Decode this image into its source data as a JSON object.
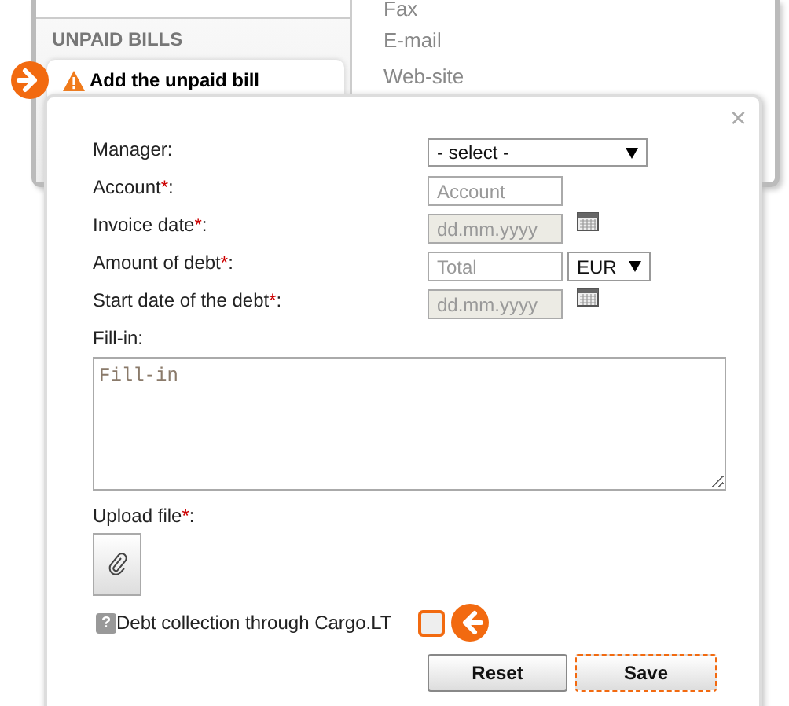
{
  "sidebar": {
    "header": "UNPAID BILLS",
    "item": {
      "label": "Add the unpaid bill",
      "highlighted": true
    }
  },
  "contacts": [
    "Fax",
    "E-mail",
    "Web-site"
  ],
  "dialog": {
    "close": "×",
    "fields": [
      {
        "kind": "select",
        "label": "Manager:",
        "value": "- select -"
      },
      {
        "kind": "text",
        "label": "Account",
        "mark": "*",
        "end": ":",
        "placeholder": "Account"
      },
      {
        "kind": "date",
        "label": "Invoice date",
        "mark": "*",
        "end": ":",
        "placeholder": "dd.mm.yyyy",
        "disabled": true
      },
      {
        "kind": "amount",
        "label": "Amount of debt",
        "mark": "*",
        "end": ":",
        "placeholder": "Total",
        "currency": "EUR"
      },
      {
        "kind": "date",
        "label": "Start date of the debt",
        "mark": "*",
        "end": ":",
        "placeholder": "dd.mm.yyyy",
        "disabled": true
      }
    ],
    "fill_in": {
      "label": "Fill-in:",
      "placeholder": "Fill-in"
    },
    "upload": {
      "label": "Upload file",
      "mark": "*",
      "end": ":"
    },
    "debt_collection": {
      "help": "?",
      "label": "Debt collection through Cargo.LT",
      "checked": false,
      "highlighted": true
    },
    "buttons": [
      {
        "label": "Reset",
        "primary": false
      },
      {
        "label": "Save",
        "primary": true
      }
    ]
  }
}
